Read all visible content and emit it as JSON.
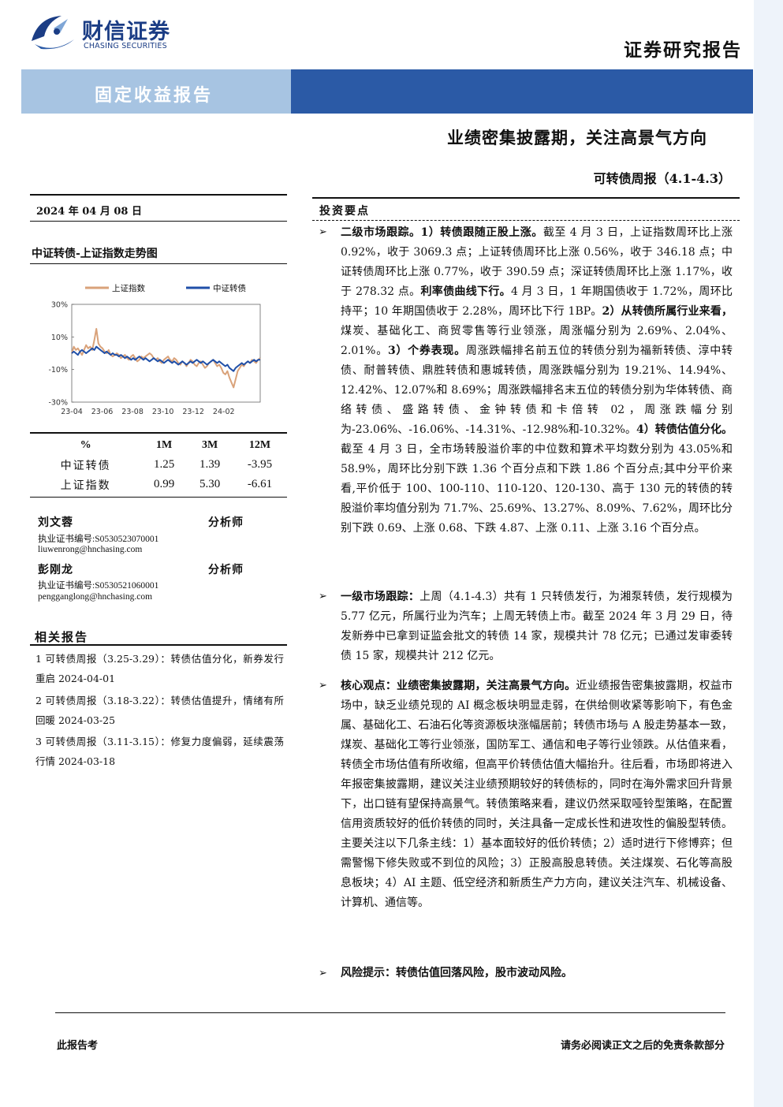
{
  "header": {
    "brand_cn": "财信证券",
    "brand_en": "CHASING SECURITIES",
    "report_type": "证券研究报告",
    "band_title": "固定收益报告",
    "main_title": "业绩密集披露期，关注高景气方向",
    "sub_title": "可转债周报（4.1-4.3）"
  },
  "colors": {
    "brand": "#1b3d85",
    "band_light": "#a7c4e2",
    "band_dark": "#2b5aa6",
    "series_sh": "#d9a27a",
    "series_cb": "#1f4fa8"
  },
  "date": "2024 年 04 月 08 日",
  "chart_title": "中证转债-上证指数走势图",
  "chart_data": {
    "type": "line",
    "series": [
      {
        "name": "上证指数",
        "color": "#d9a27a",
        "values": [
          0,
          4,
          2,
          3,
          1,
          -1,
          2,
          5,
          3,
          4,
          2,
          8,
          15,
          6,
          4,
          3,
          1,
          0,
          2,
          -1,
          -2,
          -1,
          0,
          -1,
          -3,
          -2,
          -1,
          -3,
          -4,
          -2,
          -1,
          -3,
          -5,
          -4,
          -2,
          -3,
          -2,
          -1,
          0,
          -1,
          -3,
          -4,
          -3,
          -5,
          -6,
          -4,
          -3,
          -2,
          -4,
          -5,
          -3,
          -4,
          -6,
          -7,
          -5,
          -6,
          -8,
          -6,
          -4,
          -5,
          -7,
          -8,
          -6,
          -5,
          -7,
          -9,
          -8,
          -6,
          -5,
          -4,
          -6,
          -8,
          -7,
          -9,
          -12,
          -13,
          -11,
          -15,
          -18,
          -21,
          -16,
          -11,
          -9,
          -7,
          -8,
          -6,
          -5,
          -6,
          -4,
          -5,
          -6,
          -4,
          -3
        ]
      },
      {
        "name": "中证转债",
        "color": "#1f4fa8",
        "values": [
          0,
          1,
          0,
          -1,
          1,
          2,
          1,
          0,
          1,
          2,
          3,
          2,
          4,
          3,
          2,
          1,
          0,
          1,
          0,
          -1,
          0,
          -1,
          -1,
          -2,
          -1,
          -2,
          -3,
          -2,
          -3,
          -4,
          -3,
          -4,
          -3,
          -2,
          -3,
          -4,
          -3,
          -4,
          -5,
          -4,
          -3,
          -4,
          -5,
          -4,
          -5,
          -6,
          -5,
          -4,
          -5,
          -6,
          -5,
          -6,
          -7,
          -6,
          -5,
          -6,
          -7,
          -6,
          -5,
          -6,
          -5,
          -4,
          -5,
          -6,
          -5,
          -6,
          -7,
          -6,
          -5,
          -4,
          -5,
          -6,
          -5,
          -6,
          -7,
          -8,
          -7,
          -9,
          -10,
          -11,
          -9,
          -8,
          -7,
          -6,
          -7,
          -6,
          -5,
          -6,
          -5,
          -4,
          -5,
          -4,
          -4
        ]
      }
    ],
    "x_ticks": [
      "23-04",
      "23-06",
      "23-08",
      "23-10",
      "23-12",
      "24-02"
    ],
    "y_ticks": [
      "30%",
      "10%",
      "-10%",
      "-30%"
    ],
    "ylim": [
      -30,
      30
    ],
    "legend_position": "top"
  },
  "perf_table": {
    "headers": [
      "%",
      "1M",
      "3M",
      "12M"
    ],
    "rows": [
      {
        "name": "中证转债",
        "m1": "1.25",
        "m3": "1.39",
        "m12": "-3.95"
      },
      {
        "name": "上证指数",
        "m1": "0.99",
        "m3": "5.30",
        "m12": "-6.61"
      }
    ]
  },
  "analysts": [
    {
      "name": "刘文蓉",
      "role": "分析师",
      "cert": "执业证书编号:S0530523070001",
      "email": "liuwenrong@hnchasing.com"
    },
    {
      "name": "彭刚龙",
      "role": "分析师",
      "cert": "执业证书编号:S0530521060001",
      "email": "pengganglong@hnchasing.com"
    }
  ],
  "related": {
    "title": "相关报告",
    "items": [
      "1 可转债周报（3.25-3.29）：转债估值分化，新券发行重启 2024-04-01",
      "2 可转债周报（3.18-3.22）：转债估值提升，情绪有所回暖 2024-03-25",
      "3 可转债周报（3.11-3.15）：修复力度偏弱，延续震荡行情 2024-03-18"
    ]
  },
  "summary": {
    "head": "投资要点",
    "bullet_glyph": "➢",
    "p1_t1": "二级市场跟踪。1）转债跟随正股上涨。",
    "p1_x1": "截至 4 月 3 日，上证指数周环比上涨 0.92%，收于 3069.3 点；上证转债周环比上涨 0.56%，收于 346.18 点；中证转债周环比上涨 0.77%，收于 390.59 点；深证转债周环比上涨 1.17%，收于 278.32 点。",
    "p1_t2": "利率债曲线下行。",
    "p1_x2": "4 月 3 日，1 年期国债收于 1.72%，周环比持平；10 年期国债收于 2.28%，周环比下行 1BP。",
    "p1_t3": "2）从转债所属行业来看，",
    "p1_x3": "煤炭、基础化工、商贸零售等行业领涨，周涨幅分别为 2.69%、2.04%、2.01%。",
    "p1_t4": "3）个券表现。",
    "p1_x4": "周涨跌幅排名前五位的转债分别为福新转债、淳中转债、耐普转债、鼎胜转债和惠城转债，周涨跌幅分别为 19.21%、14.94%、12.42%、12.07%和 8.69%；周涨跌幅排名末五位的转债分别为华体转债、商络转债、盛路转债、金钟转债和卡倍转 02，周涨跌幅分别为-23.06%、-16.06%、-14.31%、-12.98%和-10.32%。",
    "p1_t5": "4）转债估值分化。",
    "p1_x5": "截至 4 月 3 日，全市场转股溢价率的中位数和算术平均数分别为 43.05%和 58.9%，周环比分别下跌 1.36 个百分点和下跌 1.86 个百分点;其中分平价来看,平价低于 100、100-110、110-120、120-130、高于 130 元的转债的转股溢价率均值分别为 71.7%、25.69%、13.27%、8.09%、7.62%，周环比分别下跌 0.69、上涨 0.68、下跌 4.87、上涨 0.11、上涨 3.16 个百分点。",
    "p2_t1": "一级市场跟踪：",
    "p2_x1": "上周（4.1-4.3）共有 1 只转债发行，为湘泵转债，发行规模为 5.77 亿元，所属行业为汽车；上周无转债上市。截至 2024 年 3 月 29 日，待发新券中已拿到证监会批文的转债 14 家，规模共计 78 亿元；已通过发审委转债 15 家，规模共计 212 亿元。",
    "p3_t1": "核心观点：业绩密集披露期，关注高景气方向。",
    "p3_x1": "近业绩报告密集披露期，权益市场中，缺乏业绩兑现的 AI 概念板块明显走弱，在供给侧收紧等影响下，有色金属、基础化工、石油石化等资源板块涨幅居前；转债市场与 A 股走势基本一致，煤炭、基础化工等行业领涨，国防军工、通信和电子等行业领跌。从估值来看，转债全市场估值有所收缩，但高平价转债估值大幅抬升。往后看，市场即将进入年报密集披露期，建议关注业绩预期较好的转债标的，同时在海外需求回升背景下，出口链有望保持高景气。转债策略来看，建议仍然采取哑铃型策略，在配置信用资质较好的低价转债的同时，关注具备一定成长性和进攻性的偏股型转债。主要关注以下几条主线：1）基本面较好的低价转债；2）适时进行下修博弈；但需警惕下修失败或不到位的风险；3）正股高股息转债。关注煤炭、石化等高股息板块；4）AI 主题、低空经济和新质生产力方向，建议关注汽车、机械设备、计算机、通信等。",
    "p4_t1": "风险提示：转债估值回落风险，股市波动风险。"
  },
  "footer": {
    "left": "此报告考",
    "right": "请务必阅读正文之后的免责条款部分"
  }
}
